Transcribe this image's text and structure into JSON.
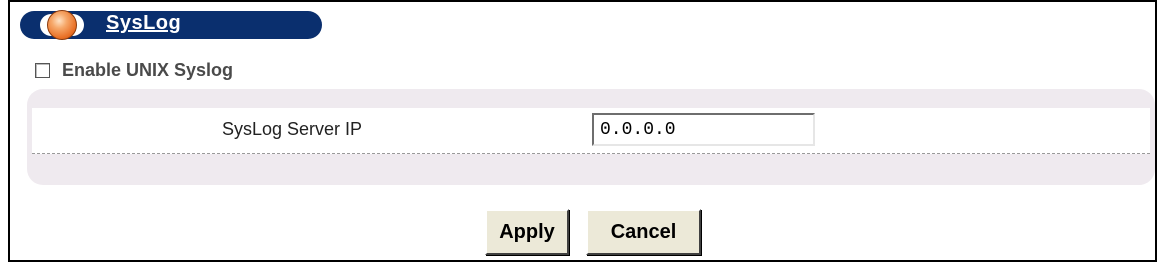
{
  "section": {
    "title": "SysLog",
    "icon": "orb-icon",
    "header_color": "#0a2f6e"
  },
  "enable": {
    "label": "Enable UNIX Syslog",
    "checked": false
  },
  "server": {
    "label": "SysLog Server IP",
    "value": "0.0.0.0"
  },
  "buttons": {
    "apply_label": "Apply",
    "cancel_label": "Cancel"
  }
}
